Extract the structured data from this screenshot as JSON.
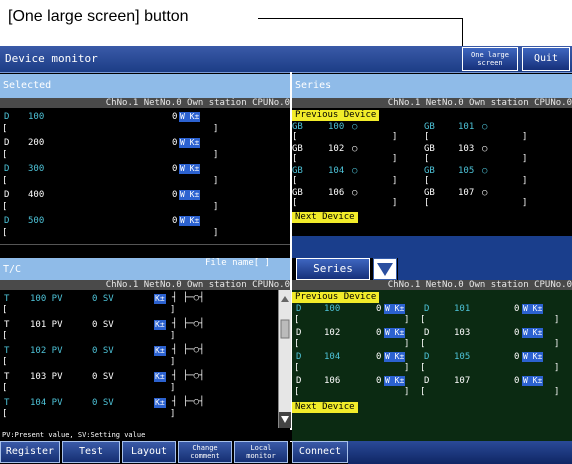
{
  "annotation": {
    "text": "[One large screen] button"
  },
  "titlebar": {
    "title": "Device monitor",
    "one_large_screen": "One large screen",
    "quit": "Quit"
  },
  "selected": {
    "header": "Selected",
    "columns": "ChNo.1 NetNo.0 Own station CPUNo.0",
    "rows": [
      {
        "dev": "D",
        "no": "100",
        "val": "0",
        "flag": "W K±",
        "br1": "[",
        "br2": "]",
        "color": "cyan"
      },
      {
        "dev": "D",
        "no": "200",
        "val": "0",
        "flag": "W K±",
        "br1": "[",
        "br2": "]",
        "color": "white"
      },
      {
        "dev": "D",
        "no": "300",
        "val": "0",
        "flag": "W K±",
        "br1": "[",
        "br2": "]",
        "color": "cyan"
      },
      {
        "dev": "D",
        "no": "400",
        "val": "0",
        "flag": "W K±",
        "br1": "[",
        "br2": "]",
        "color": "white"
      },
      {
        "dev": "D",
        "no": "500",
        "val": "0",
        "flag": "W K±",
        "br1": "[",
        "br2": "]",
        "color": "cyan"
      }
    ]
  },
  "series_top": {
    "header": "Series",
    "columns": "ChNo.1 NetNo.0 Own station CPUNo.0",
    "prev": "Previous Device",
    "next": "Next Device",
    "rows": [
      {
        "l": "GB",
        "ln": "100",
        "r": "GB",
        "rn": "101",
        "color": "cyan"
      },
      {
        "l": "GB",
        "ln": "102",
        "r": "GB",
        "rn": "103",
        "color": "white"
      },
      {
        "l": "GB",
        "ln": "104",
        "r": "GB",
        "rn": "105",
        "color": "cyan"
      },
      {
        "l": "GB",
        "ln": "106",
        "r": "GB",
        "rn": "107",
        "color": "white"
      }
    ]
  },
  "tc": {
    "header": "T/C",
    "file": "File name[      ]",
    "columns": "ChNo.1 NetNo.0 Own station CPUNo.0",
    "rows": [
      {
        "dev": "T",
        "pv": "100 PV",
        "sv": "0 SV",
        "flag": "K±",
        "color": "cyan"
      },
      {
        "dev": "T",
        "pv": "101 PV",
        "sv": "0 SV",
        "flag": "K±",
        "color": "white"
      },
      {
        "dev": "T",
        "pv": "102 PV",
        "sv": "0 SV",
        "flag": "K±",
        "color": "cyan"
      },
      {
        "dev": "T",
        "pv": "103 PV",
        "sv": "0 SV",
        "flag": "K±",
        "color": "white"
      },
      {
        "dev": "T",
        "pv": "104 PV",
        "sv": "0 SV",
        "flag": "K±",
        "color": "cyan"
      }
    ],
    "status": "PV:Present value, SV:Setting value"
  },
  "series_bottom": {
    "dropdown": "Series",
    "columns": "ChNo.1 NetNo.0 Own station CPUNo.0",
    "prev": "Previous Device",
    "next": "Next Device",
    "rows": [
      {
        "l": "D",
        "ln": "100",
        "lv": "0",
        "r": "D",
        "rn": "101",
        "rv": "0",
        "flag": "W K±",
        "color": "cyan"
      },
      {
        "l": "D",
        "ln": "102",
        "lv": "0",
        "r": "D",
        "rn": "103",
        "rv": "0",
        "flag": "W K±",
        "color": "white"
      },
      {
        "l": "D",
        "ln": "104",
        "lv": "0",
        "r": "D",
        "rn": "105",
        "rv": "0",
        "flag": "W K±",
        "color": "cyan"
      },
      {
        "l": "D",
        "ln": "106",
        "lv": "0",
        "r": "D",
        "rn": "107",
        "rv": "0",
        "flag": "W K±",
        "color": "white"
      }
    ]
  },
  "tabs": {
    "register": "Register",
    "test": "Test",
    "layout": "Layout",
    "change_comment": "Change comment",
    "local_monitor": "Local monitor",
    "connect": "Connect"
  },
  "colors": {
    "cyan": "#4ec3d8",
    "white": "#ffffff",
    "header": "#8fbbe8",
    "title": "#1c3d86",
    "yellow": "#f2ec2a"
  }
}
